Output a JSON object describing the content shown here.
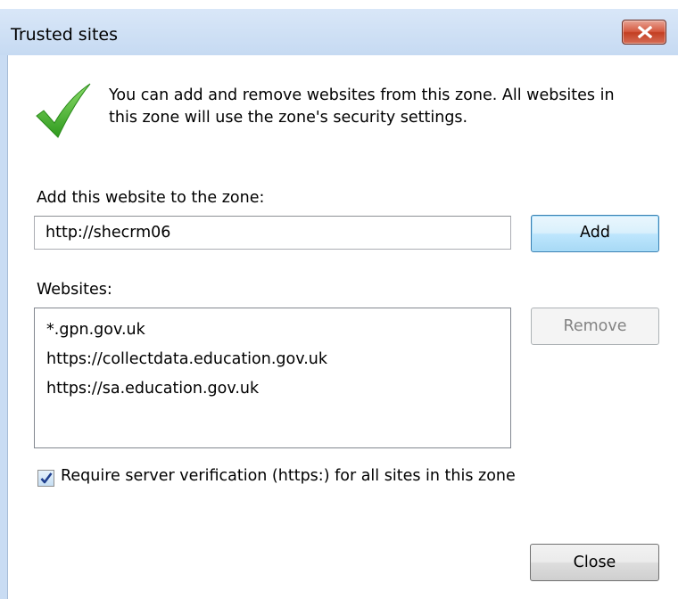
{
  "window": {
    "title": "Trusted sites"
  },
  "info": {
    "icon": "checkmark-icon",
    "text_line1": "You can add and remove websites from this zone. All websites in",
    "text_line2": "this zone will use the zone's security settings."
  },
  "add_section": {
    "label": "Add this website to the zone:",
    "input_value": "http://shecrm06",
    "add_button": "Add"
  },
  "websites_section": {
    "label": "Websites:",
    "items": [
      "*.gpn.gov.uk",
      "https://collectdata.education.gov.uk",
      "https://sa.education.gov.uk"
    ],
    "remove_button": "Remove"
  },
  "verification": {
    "checked": true,
    "label": "Require server verification (https:) for all sites in this zone"
  },
  "footer": {
    "close_button": "Close"
  },
  "colors": {
    "titlebar": "#c9dcf3",
    "close_button": "#c9432a",
    "check_green": "#3fae2a",
    "disabled_text": "#838383"
  }
}
